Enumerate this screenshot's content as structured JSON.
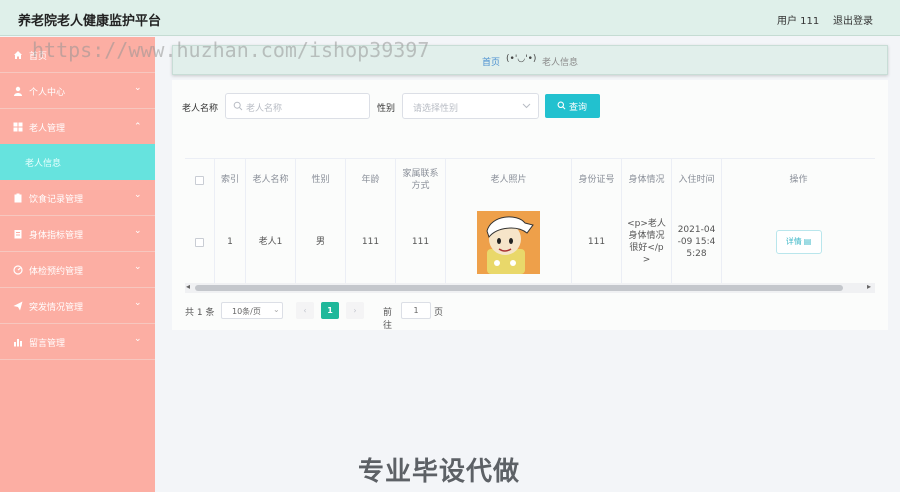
{
  "header": {
    "title": "养老院老人健康监护平台",
    "user": "用户 111",
    "logout": "退出登录"
  },
  "sidebar": {
    "items": [
      {
        "label": "首页",
        "icon": "home-icon"
      },
      {
        "label": "个人中心",
        "icon": "user-icon"
      },
      {
        "label": "老人管理",
        "icon": "grid-icon"
      },
      {
        "label": "饮食记录管理",
        "icon": "clipboard-icon"
      },
      {
        "label": "身体指标管理",
        "icon": "document-icon"
      },
      {
        "label": "体检预约管理",
        "icon": "dashboard-icon"
      },
      {
        "label": "突发情况管理",
        "icon": "send-icon"
      },
      {
        "label": "留言管理",
        "icon": "bar-chart-icon"
      }
    ],
    "submenu": {
      "label": "老人信息"
    }
  },
  "breadcrumb": {
    "home": "首页",
    "emoji": "(•'◡'•)",
    "current": "老人信息"
  },
  "search": {
    "name_label": "老人名称",
    "name_placeholder": "老人名称",
    "gender_label": "性别",
    "gender_placeholder": "请选择性别",
    "query_button": "查询"
  },
  "table": {
    "headers": [
      "索引",
      "老人名称",
      "性别",
      "年龄",
      "家属联系方式",
      "老人照片",
      "身份证号",
      "身体情况",
      "入住时间",
      "操作"
    ],
    "rows": [
      {
        "index": "1",
        "name": "老人1",
        "gender": "男",
        "age": "111",
        "contact": "111",
        "id": "111",
        "health": "<p>老人身体情况很好</p>",
        "checkin": "2021-04-09 15:45:28",
        "action": "详情"
      }
    ]
  },
  "pager": {
    "total": "共 1 条",
    "size": "10条/页",
    "page": "1",
    "goto": "前往",
    "goto_value": "1",
    "page_unit": "页"
  },
  "overlay": {
    "watermark": "https://www.huzhan.com/ishop39397",
    "banner": "专业毕设代做"
  }
}
